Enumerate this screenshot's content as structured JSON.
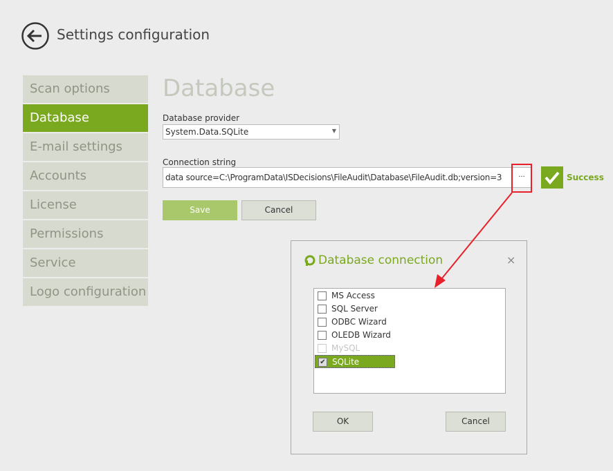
{
  "header": {
    "title": "Settings configuration",
    "back_icon": "arrow-left-circle-icon"
  },
  "sidebar": {
    "items": [
      {
        "label": "Scan options",
        "active": false
      },
      {
        "label": "Database",
        "active": true
      },
      {
        "label": "E-mail settings",
        "active": false
      },
      {
        "label": "Accounts",
        "active": false
      },
      {
        "label": "License",
        "active": false
      },
      {
        "label": "Permissions",
        "active": false
      },
      {
        "label": "Service",
        "active": false
      },
      {
        "label": "Logo configuration",
        "active": false
      }
    ]
  },
  "main": {
    "heading": "Database",
    "provider_label": "Database provider",
    "provider_value": "System.Data.SQLite",
    "connection_label": "Connection string",
    "connection_value": "data source=C:\\ProgramData\\ISDecisions\\FileAudit\\Database\\FileAudit.db;version=3",
    "browse_label": "···",
    "status": "Success",
    "save_label": "Save",
    "cancel_label": "Cancel"
  },
  "dialog": {
    "title": "Database connection",
    "close": "×",
    "options": [
      {
        "label": "MS Access",
        "checked": false,
        "disabled": false
      },
      {
        "label": "SQL Server",
        "checked": false,
        "disabled": false
      },
      {
        "label": "ODBC Wizard",
        "checked": false,
        "disabled": false
      },
      {
        "label": "OLEDB Wizard",
        "checked": false,
        "disabled": false
      },
      {
        "label": "MySQL",
        "checked": false,
        "disabled": true
      },
      {
        "label": "SQLite",
        "checked": true,
        "disabled": false
      }
    ],
    "ok_label": "OK",
    "cancel_label": "Cancel"
  },
  "colors": {
    "accent": "#7aa81e",
    "annotation": "#e8202a"
  }
}
